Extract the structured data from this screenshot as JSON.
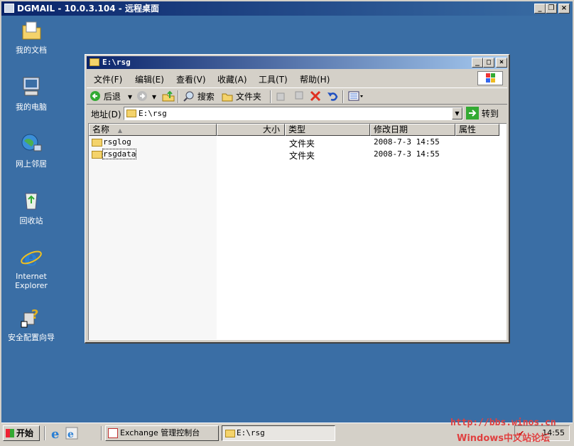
{
  "rdp": {
    "title": "DGMAIL - 10.0.3.104 - 远程桌面"
  },
  "desktop": {
    "icons": [
      {
        "label": "我的文档",
        "icon": "my-documents-icon"
      },
      {
        "label": "我的电脑",
        "icon": "my-computer-icon"
      },
      {
        "label": "网上邻居",
        "icon": "network-places-icon"
      },
      {
        "label": "回收站",
        "icon": "recycle-bin-icon"
      },
      {
        "label": "Internet Explorer",
        "icon": "internet-explorer-icon"
      },
      {
        "label": "安全配置向导",
        "icon": "security-wizard-icon"
      }
    ]
  },
  "explorer": {
    "title": "E:\\rsg",
    "menus": [
      "文件(F)",
      "编辑(E)",
      "查看(V)",
      "收藏(A)",
      "工具(T)",
      "帮助(H)"
    ],
    "toolbar": {
      "back": "后退",
      "search": "搜索",
      "folders": "文件夹"
    },
    "address": {
      "label": "地址(D)",
      "value": "E:\\rsg",
      "go": "转到"
    },
    "columns": [
      "名称",
      "大小",
      "类型",
      "修改日期",
      "属性"
    ],
    "rows": [
      {
        "name": "rsglog",
        "size": "",
        "type": "文件夹",
        "date": "2008-7-3 14:55",
        "attr": ""
      },
      {
        "name": "rsgdata",
        "size": "",
        "type": "文件夹",
        "date": "2008-7-3 14:55",
        "attr": ""
      }
    ]
  },
  "taskbar": {
    "start": "开始",
    "tasks": [
      {
        "label": "Exchange 管理控制台"
      },
      {
        "label": "E:\\rsg"
      }
    ],
    "clock": "14:55"
  },
  "watermark": {
    "url": "http://bbs.winos.cn",
    "text": "Windows中文站论坛"
  }
}
